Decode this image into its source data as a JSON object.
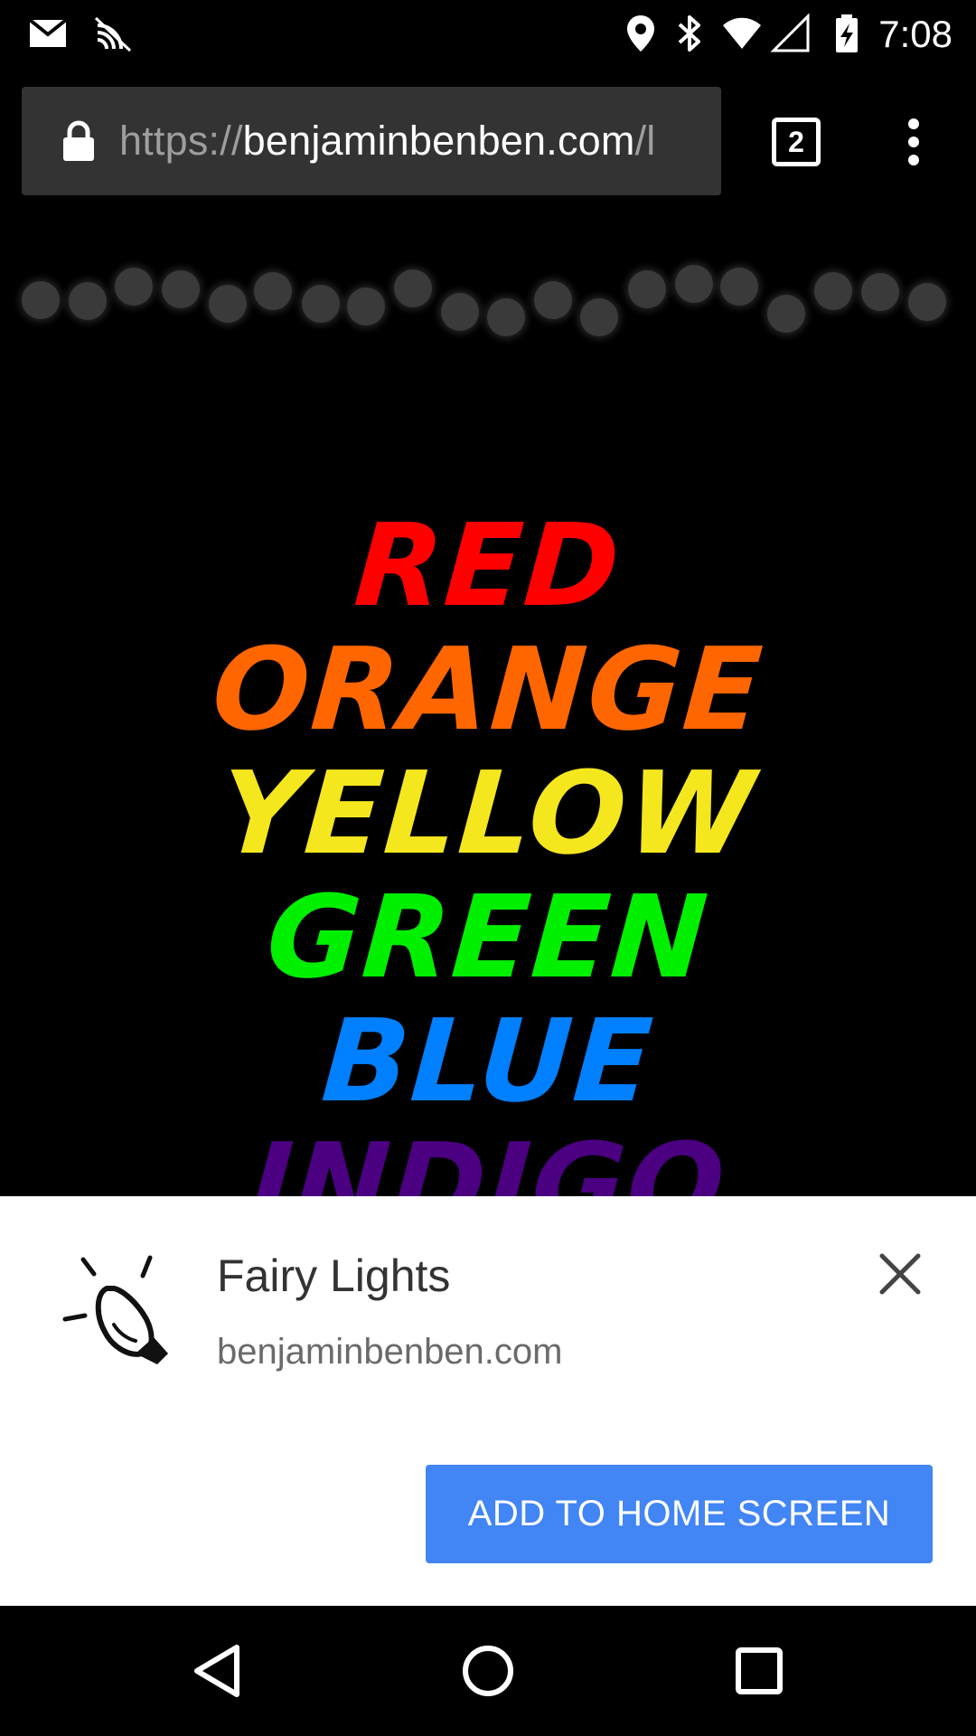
{
  "status_bar": {
    "time": "7:08",
    "left_icons": [
      "gmail-icon",
      "cast-off-icon"
    ],
    "right_icons": [
      "location-icon",
      "bluetooth-icon",
      "wifi-icon",
      "cell-signal-icon",
      "battery-charging-icon"
    ]
  },
  "browser": {
    "url_scheme": "https://",
    "url_host": "benjaminbenben.com",
    "url_path": "/l",
    "tab_count": "2",
    "menu_icon": "overflow-menu-icon"
  },
  "page": {
    "light_color": "#3a3a3a",
    "words": [
      {
        "text": "RED",
        "color": "#ff0000"
      },
      {
        "text": "ORANGE",
        "color": "#ff6600"
      },
      {
        "text": "YELLOW",
        "color": "#f5e71e"
      },
      {
        "text": "GREEN",
        "color": "#00f000"
      },
      {
        "text": "BLUE",
        "color": "#0080ff"
      },
      {
        "text": "INDIGO",
        "color": "#4b0082"
      }
    ]
  },
  "install_banner": {
    "app_name": "Fairy Lights",
    "origin": "benjaminbenben.com",
    "button_label": "ADD TO HOME SCREEN",
    "button_color": "#4285f4",
    "icon": "light-bulb-icon",
    "close_icon": "close-icon"
  },
  "nav_bar": {
    "back_icon": "back-icon",
    "home_icon": "home-icon",
    "recents_icon": "recents-icon"
  }
}
